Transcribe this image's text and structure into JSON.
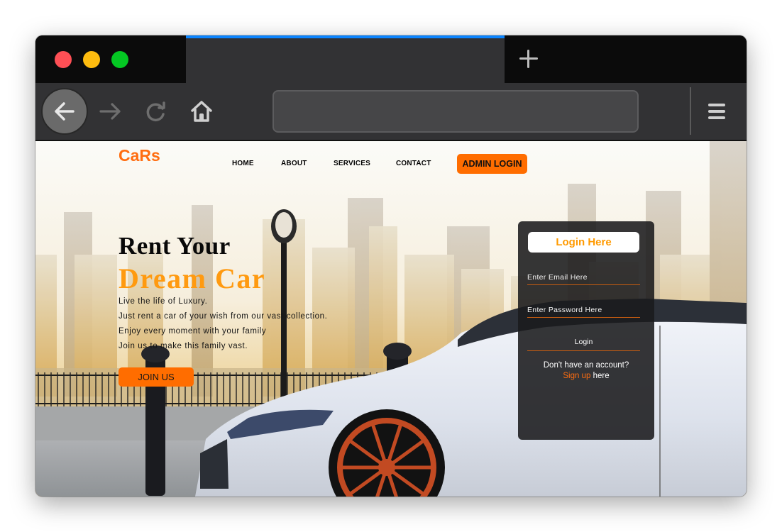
{
  "browser": {
    "tab_title": "",
    "url": "",
    "colors": {
      "tab_accent": "#0a84ff",
      "titlebar": "#0b0b0b",
      "toolbar": "#323234"
    }
  },
  "site": {
    "logo": "CaRs",
    "nav": [
      {
        "label": "HOME"
      },
      {
        "label": "ABOUT"
      },
      {
        "label": "SERVICES"
      },
      {
        "label": "CONTACT"
      }
    ],
    "admin_login_label": "ADMIN LOGIN",
    "hero": {
      "title_line1": "Rent Your",
      "title_line2": "Dream Car",
      "lines": [
        "Live the life of Luxury.",
        "Just rent a car of your wish from our vast collection.",
        "Enjoy every moment with your family",
        "Join us to make this family vast."
      ],
      "cta_label": "JOIN US"
    },
    "login": {
      "title": "Login Here",
      "email_placeholder": "Enter Email Here",
      "email_value": "",
      "password_placeholder": "Enter Password Here",
      "password_value": "",
      "submit_label": "Login",
      "signup_question": "Don't have an account?",
      "signup_link": "Sign up",
      "signup_suffix": " here"
    },
    "colors": {
      "brand_orange": "#ff6d00",
      "title_orange": "#ff9a10"
    }
  }
}
